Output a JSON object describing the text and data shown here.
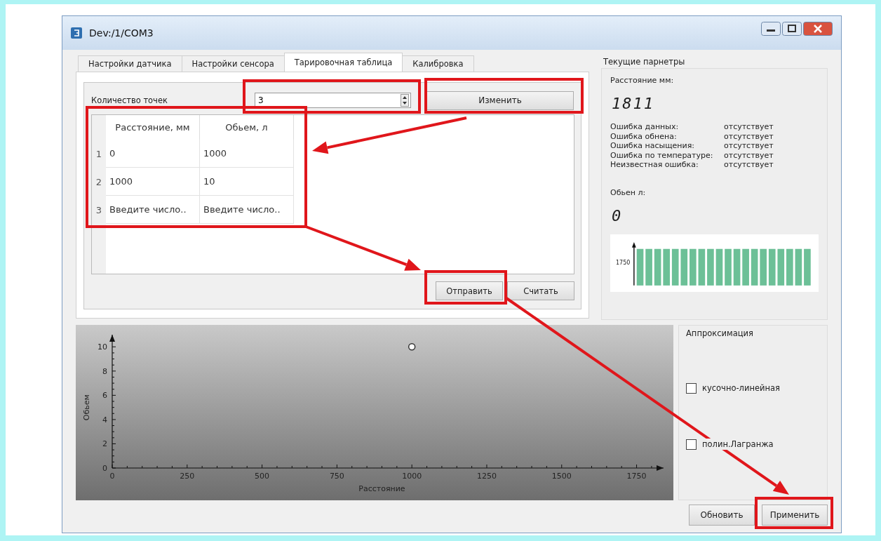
{
  "window": {
    "title": "Dev:/1/COM3"
  },
  "tabs": [
    {
      "label": "Настройки датчика",
      "selected": false
    },
    {
      "label": "Настройки сенсора",
      "selected": false
    },
    {
      "label": "Тарировочная таблица",
      "selected": true
    },
    {
      "label": "Калибровка",
      "selected": false
    }
  ],
  "points": {
    "label": "Количество точек",
    "value": "3",
    "button": "Изменить"
  },
  "table": {
    "columns": [
      "Расстояние, мм",
      "Обьем, л"
    ],
    "rows": [
      {
        "index": "1",
        "cells": [
          "0",
          "1000"
        ]
      },
      {
        "index": "2",
        "cells": [
          "1000",
          "10"
        ]
      },
      {
        "index": "3",
        "cells": [
          "Введите число..",
          "Введите число.."
        ]
      }
    ]
  },
  "table_buttons": [
    "Отправить",
    "Считать"
  ],
  "chart": {
    "chart_data": {
      "type": "scatter",
      "xlabel": "Расстояние",
      "ylabel": "Обьем",
      "x": [
        1000
      ],
      "values": [
        10
      ],
      "xlim": [
        0,
        1840
      ],
      "ylim": [
        0,
        11
      ],
      "xticks": [
        0,
        250,
        500,
        750,
        1000,
        1250,
        1500,
        1750
      ],
      "yticks": [
        0,
        2,
        4,
        6,
        8,
        10
      ]
    }
  },
  "params": {
    "title": "Текущие парнетры",
    "distance_label": "Расстояние мм:",
    "distance": "1811",
    "errors": [
      {
        "name": "Ошибка данных:",
        "value": "отсутствует"
      },
      {
        "name": "Ошибка обнена:",
        "value": "отсутствует"
      },
      {
        "name": "Ошибка насыщения:",
        "value": "отсутствует"
      },
      {
        "name": "Ошибка по температуре:",
        "value": "отсутствует"
      },
      {
        "name": "Неизвестная ошибка:",
        "value": "отсутствует"
      }
    ],
    "volume_label": "Обьен л:",
    "volume": "0",
    "mini_chart_label": "1750"
  },
  "approximation": {
    "title": "Аппроксимация",
    "options": [
      {
        "label": "кусочно-линейная",
        "checked": false
      },
      {
        "label": "полин.Лагранжа",
        "checked": false
      }
    ]
  },
  "buttons": [
    "Обновить",
    "Применить"
  ]
}
